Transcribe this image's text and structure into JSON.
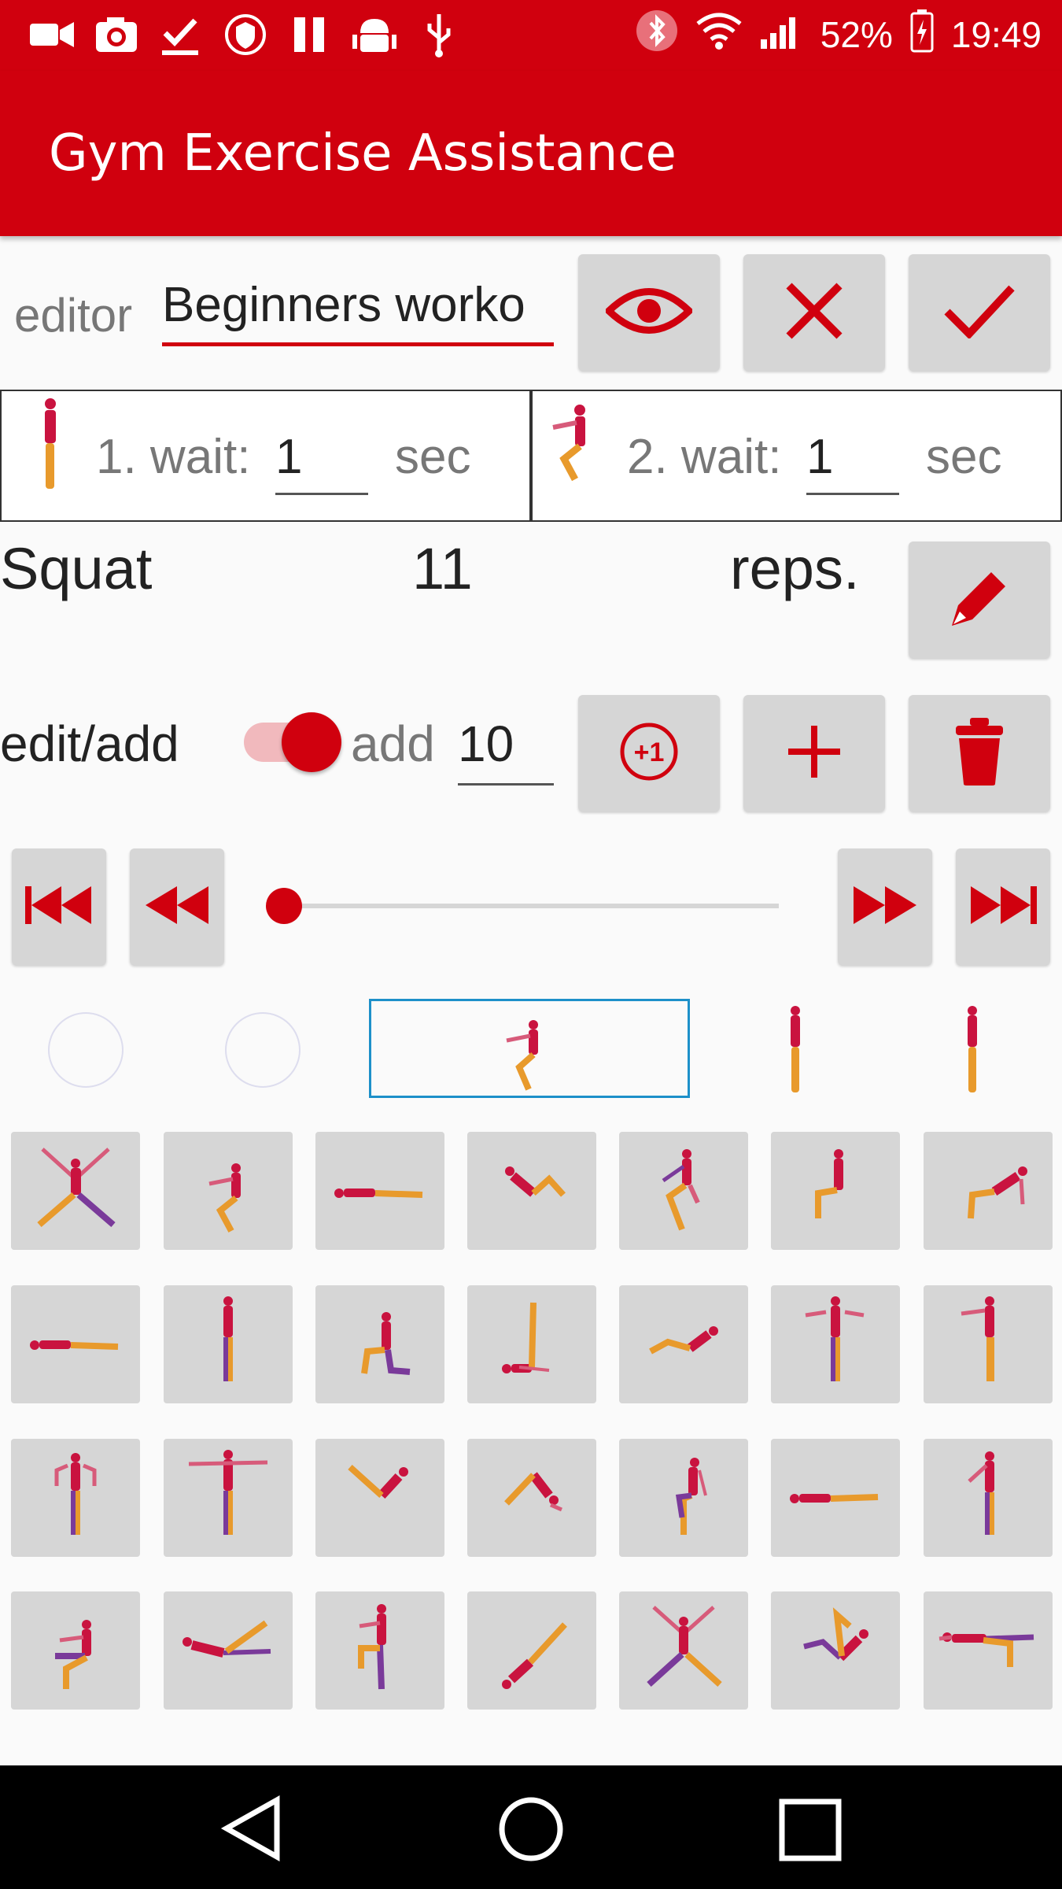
{
  "status_bar": {
    "battery": "52%",
    "time": "19:49"
  },
  "app": {
    "title": "Gym Exercise Assistance"
  },
  "editor": {
    "label": "editor",
    "workout_name": "Beginners worko",
    "buttons": [
      "eye-icon",
      "close-icon",
      "check-icon"
    ]
  },
  "waits": [
    {
      "prefix": "1. wait:",
      "value": "1",
      "unit": "sec"
    },
    {
      "prefix": "2. wait:",
      "value": "1",
      "unit": "sec"
    }
  ],
  "exercise": {
    "name": "Squat",
    "count": "11",
    "unit": "reps."
  },
  "mode": {
    "label": "edit/add",
    "toggle_on": true,
    "add_label": "add",
    "add_value": "10"
  },
  "player": {
    "progress": 0.0
  },
  "colors": {
    "accent": "#d0000e",
    "button_bg": "#d6d6d6",
    "selection": "#1d90c9"
  }
}
